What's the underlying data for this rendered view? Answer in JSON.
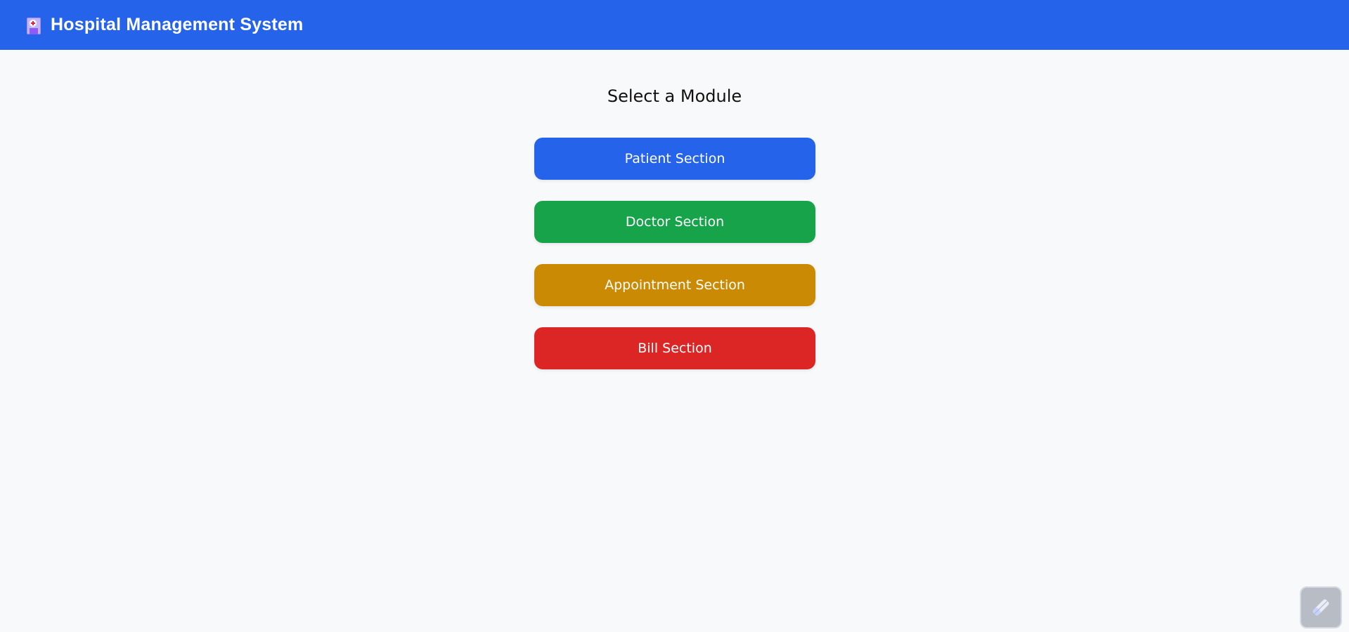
{
  "header": {
    "icon": "hospital-icon",
    "title": "Hospital Management System",
    "background": "#2563eb"
  },
  "main": {
    "title": "Select a Module",
    "modules": [
      {
        "label": "Patient Section",
        "color": "#2563eb"
      },
      {
        "label": "Doctor Section",
        "color": "#16a34a"
      },
      {
        "label": "Appointment Section",
        "color": "#ca8a04"
      },
      {
        "label": "Bill Section",
        "color": "#dc2626"
      }
    ]
  },
  "floating_widget": {
    "icon": "pencil-icon"
  }
}
